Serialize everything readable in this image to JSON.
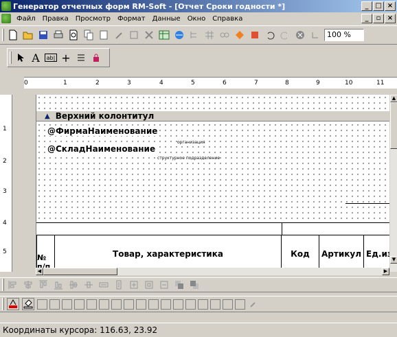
{
  "window": {
    "title": "Генератор отчетных форм RM-Soft - [Отчет Сроки годности *]",
    "buttons": [
      "_",
      "□",
      "×"
    ]
  },
  "menu": {
    "items": [
      "Файл",
      "Правка",
      "Просмотр",
      "Формат",
      "Данные",
      "Окно",
      "Справка"
    ],
    "doc_buttons": [
      "_",
      "▫",
      "×"
    ]
  },
  "toolbar": {
    "icons": [
      "new-file-icon",
      "open-folder-icon",
      "save-icon",
      "print-setup-icon",
      "print-preview-icon",
      "copy-icon",
      "paste-icon",
      "format-painter-icon",
      "edit-icon",
      "delete-icon",
      "table-icon",
      "browser-icon",
      "tree-icon",
      "grid-icon",
      "link-icon",
      "diamond-icon",
      "brush-icon",
      "undo-icon",
      "redo-icon",
      "stop-icon",
      "zoom-icon"
    ],
    "zoom_value": "100 %"
  },
  "tools": {
    "icons": [
      "pointer-icon",
      "text-icon",
      "field-icon",
      "line-icon",
      "list-icon",
      "lock-icon"
    ],
    "labels": [
      "A",
      "ab|",
      "+"
    ]
  },
  "ruler": {
    "h_marks": [
      "1",
      "2",
      "3",
      "4",
      "5",
      "6",
      "7",
      "8",
      "9",
      "10",
      "11"
    ],
    "v_marks": [
      "1",
      "2",
      "3",
      "4",
      "5"
    ]
  },
  "designer": {
    "band_title": "Верхний колонтитул",
    "field_org": "@ФирмаНаименование",
    "caption_org": "организация",
    "field_store": "@СкладНаименование",
    "caption_store": "структурное подразделение",
    "columns": [
      "№ п/п",
      "Товар, характеристика",
      "Код",
      "Артикул",
      "Ед.изм"
    ]
  },
  "status": {
    "text": "Координаты курсора: 116.63, 23.92"
  }
}
